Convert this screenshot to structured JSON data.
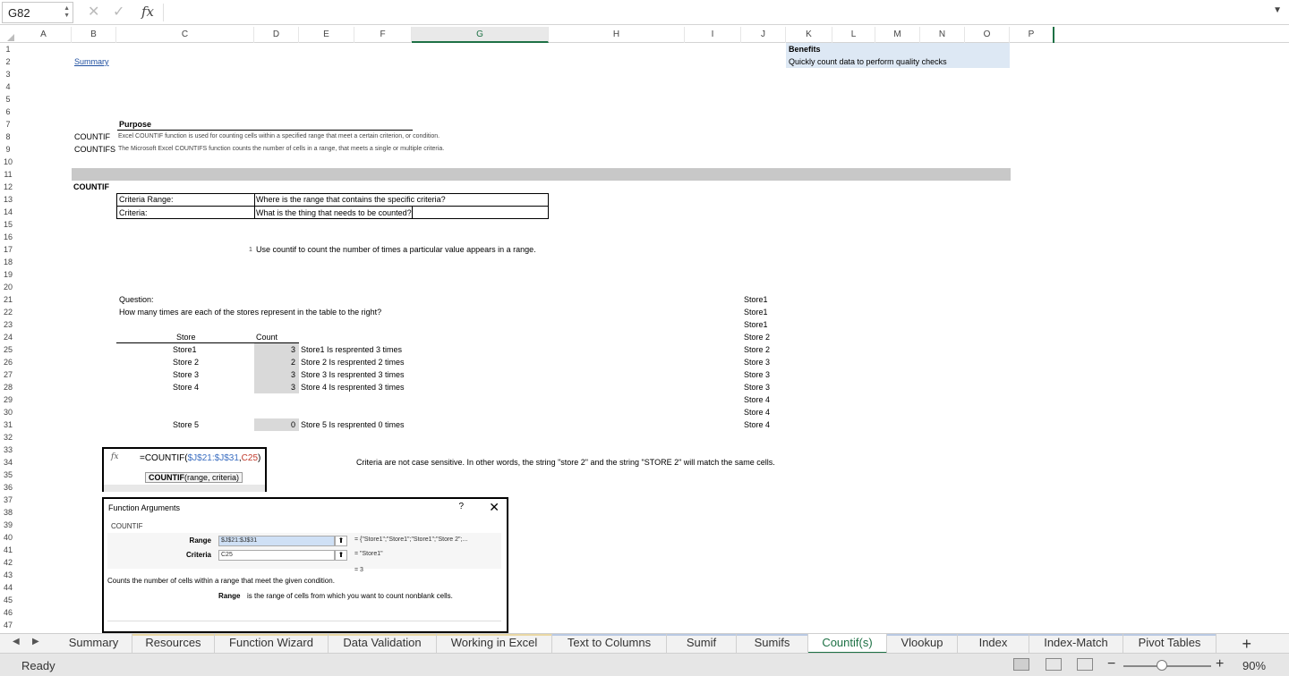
{
  "formula_bar": {
    "name_box": "G82",
    "cancel_glyph": "✕",
    "enter_glyph": "✓",
    "fx_label": "fx",
    "formula": ""
  },
  "columns": [
    "A",
    "B",
    "C",
    "D",
    "E",
    "F",
    "G",
    "H",
    "I",
    "J",
    "K",
    "L",
    "M",
    "N",
    "O",
    "P"
  ],
  "selected_column": "G",
  "rows": [
    "1",
    "2",
    "3",
    "4",
    "5",
    "6",
    "7",
    "8",
    "9",
    "10",
    "11",
    "12",
    "13",
    "14",
    "15",
    "16",
    "17",
    "18",
    "19",
    "20",
    "21",
    "22",
    "23",
    "24",
    "25",
    "26",
    "27",
    "28",
    "29",
    "30",
    "31",
    "32",
    "33",
    "34",
    "35",
    "36",
    "37",
    "38",
    "39",
    "40",
    "41",
    "42",
    "43",
    "44",
    "45",
    "46",
    "47"
  ],
  "sheet": {
    "summary_link": "Summary",
    "benefits_title": "Benefits",
    "benefits_text": "Quickly count data to perform quality checks",
    "purpose_title": "Purpose",
    "countif_label": "COUNTIF",
    "countif_desc": "Excel COUNTIF function is used for counting cells within a specified range that meet a certain criterion, or condition.",
    "countifs_label": "COUNTIFS",
    "countifs_desc": "The Microsoft Excel COUNTIFS function counts the number of cells in a range, that meets a single or multiple criteria.",
    "section_title": "COUNTIF",
    "criteria_range_label": "Criteria Range:",
    "criteria_range_desc": "Where is the range that contains the specific criteria?",
    "criteria_label": "Criteria:",
    "criteria_desc": "What is the thing that needs to be counted?",
    "step_number": "1",
    "step_text": "Use countif to count the number of times a particular value appears in a range.",
    "question_label": "Question:",
    "question_text": "How many times are each of the stores represent in the table to the right?",
    "store_header": "Store",
    "count_header": "Count",
    "results": [
      {
        "store": "Store1",
        "count": "3",
        "note": "Store1 Is resprented 3 times"
      },
      {
        "store": "Store 2",
        "count": "2",
        "note": "Store 2 Is resprented 2 times"
      },
      {
        "store": "Store 3",
        "count": "3",
        "note": "Store 3 Is resprented 3 times"
      },
      {
        "store": "Store 4",
        "count": "3",
        "note": "Store 4 Is resprented 3 times"
      },
      {
        "store": "Store 5",
        "count": "0",
        "note": "Store 5 Is resprented 0 times"
      }
    ],
    "store_list": [
      "Store1",
      "Store1",
      "Store1",
      "Store 2",
      "Store 2",
      "Store 3",
      "Store 3",
      "Store 3",
      "Store 4",
      "Store 4",
      "Store 4"
    ],
    "case_note": "Criteria are not case sensitive. In other words, the string \"store 2\" and the string \"STORE 2\" will match the same cells."
  },
  "snippet": {
    "fx": "fx",
    "f_prefix": "=COUNTIF(",
    "f_range": "$J$21:$J$31",
    "f_sep": ",",
    "f_crit": "C25",
    "f_close": ")",
    "tip_name": "COUNTIF",
    "tip_args": "(range, criteria)",
    "cut_char": "("
  },
  "dialog": {
    "title": "Function Arguments",
    "help": "?",
    "close": "✕",
    "group": "COUNTIF",
    "range_label": "Range",
    "range_value": "$J$21:$J$31",
    "range_result": "= {\"Store1\";\"Store1\";\"Store1\";\"Store 2\";...",
    "criteria_label": "Criteria",
    "criteria_value": "C25",
    "criteria_result": "= \"Store1\"",
    "collapse_glyph": "⬆",
    "result": "= 3",
    "desc": "Counts the number of cells within a range that meet the given condition.",
    "arg_name": "Range",
    "arg_desc": "is the range of cells from which you want to count nonblank cells."
  },
  "tabs": [
    {
      "label": "Summary"
    },
    {
      "label": "Resources"
    },
    {
      "label": "Function Wizard"
    },
    {
      "label": "Data Validation"
    },
    {
      "label": "Working in Excel"
    },
    {
      "label": "Text to Columns"
    },
    {
      "label": "Sumif"
    },
    {
      "label": "Sumifs"
    },
    {
      "label": "Countif(s)"
    },
    {
      "label": "Vlookup"
    },
    {
      "label": "Index"
    },
    {
      "label": "Index-Match"
    },
    {
      "label": "Pivot Tables"
    }
  ],
  "active_tab": "Countif(s)",
  "tab_nav": {
    "prev": "◀",
    "next": "▶",
    "add": "+"
  },
  "status": {
    "text": "Ready",
    "zoom": "90%",
    "minus": "−",
    "plus": "+"
  },
  "colors": {
    "accent": "#1e7145",
    "selection_fill": "#d9d9d9",
    "link": "#1f4fa0",
    "benefits_fill": "#dde8f4"
  }
}
